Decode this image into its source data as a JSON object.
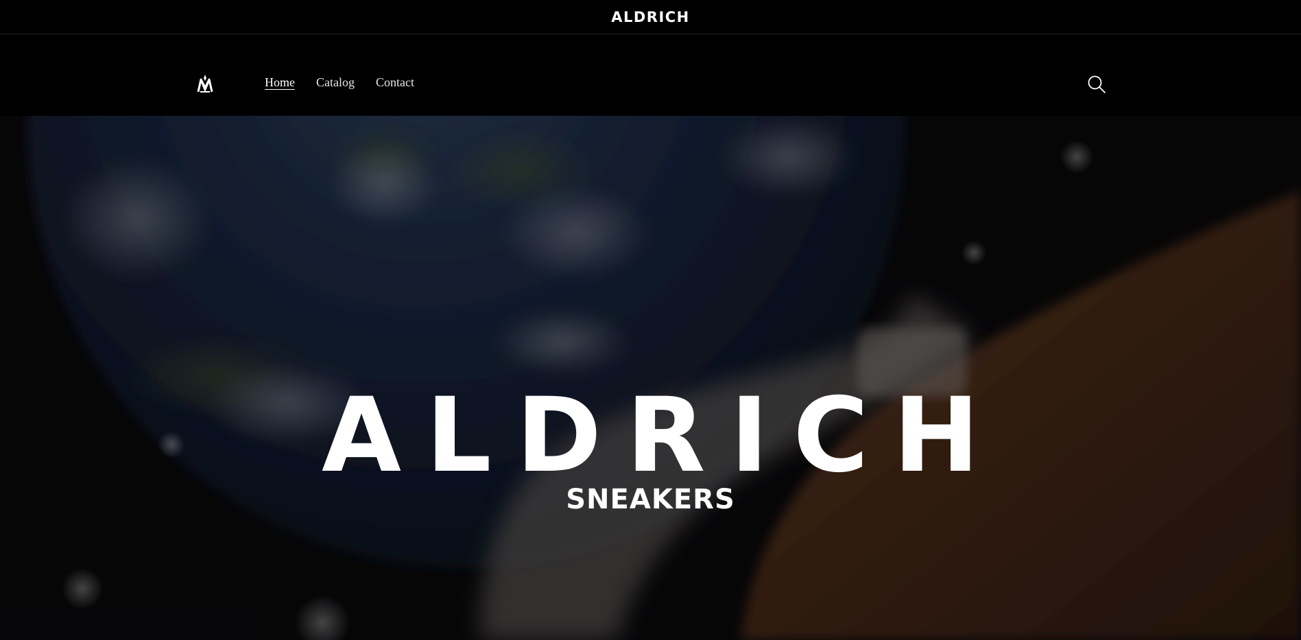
{
  "announcement": {
    "text": "ALDRICH"
  },
  "header": {
    "logo_icon": "aldrich-crown-logo-icon",
    "nav": [
      {
        "label": "Home",
        "active": true
      },
      {
        "label": "Catalog",
        "active": false
      },
      {
        "label": "Contact",
        "active": false
      }
    ],
    "search_icon": "search-icon"
  },
  "hero": {
    "title": "ALDRICH",
    "subtitle": "SNEAKERS"
  },
  "colors": {
    "background": "#000000",
    "text": "#ffffff"
  }
}
